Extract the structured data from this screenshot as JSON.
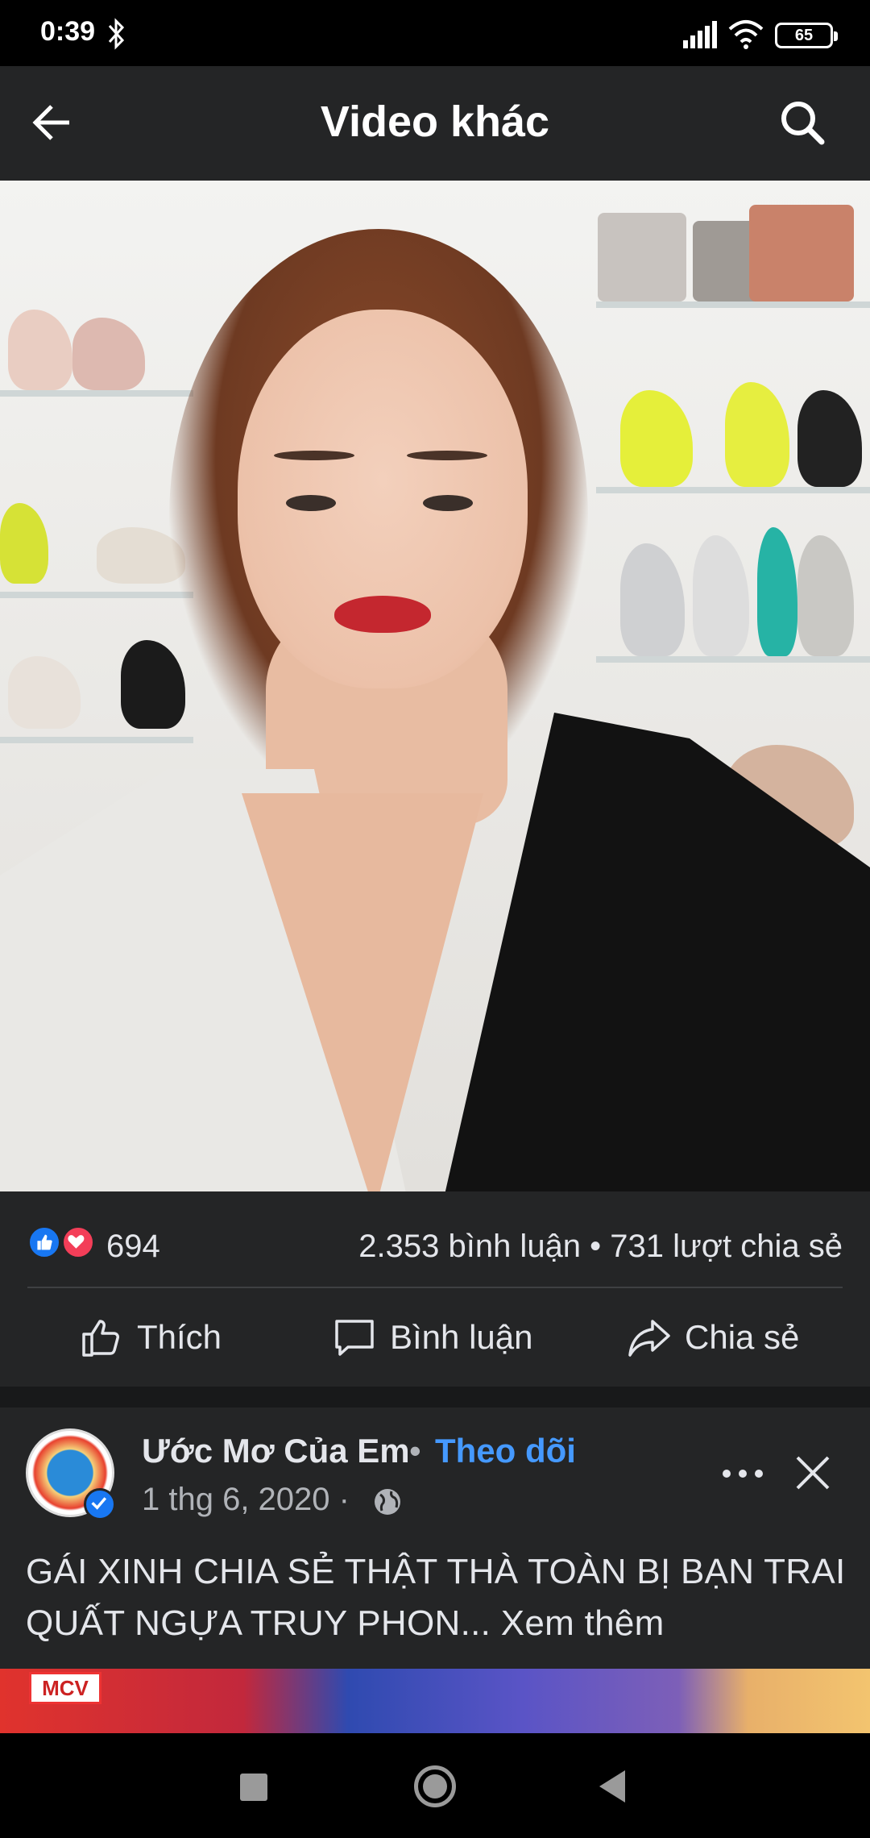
{
  "status_bar": {
    "time": "0:39",
    "battery": "65"
  },
  "header": {
    "title": "Video khác"
  },
  "stats": {
    "reaction_count": "694",
    "comments_shares": "2.353 bình luận • 731 lượt chia sẻ"
  },
  "actions": {
    "like": "Thích",
    "comment": "Bình luận",
    "share": "Chia sẻ"
  },
  "post": {
    "page_name": "Ước Mơ Của Em",
    "separator": "•",
    "follow": "Theo dõi",
    "date": "1 thg 6, 2020 ·",
    "caption": "GÁI XINH CHIA SẺ THẬT THÀ TOÀN BỊ BẠN TRAI QUẤT NGỰA TRUY PHON...",
    "see_more": " Xem thêm"
  },
  "next_video": {
    "logo_text": "MCV"
  },
  "colors": {
    "background": "#242526",
    "accent": "#4599ff",
    "like": "#1877f2",
    "love": "#f33e58"
  }
}
